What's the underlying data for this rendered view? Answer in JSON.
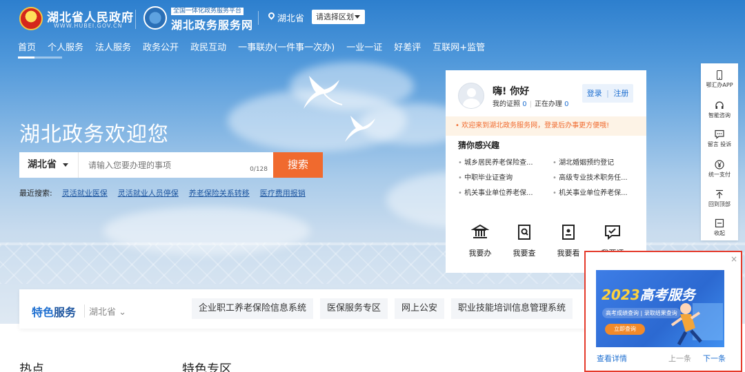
{
  "header": {
    "gov_name": "湖北省人民政府",
    "gov_url": "WWW.HUBEI.GOV.CN",
    "portal_tag": "全国一体化政务服务平台",
    "portal_name": "湖北政务服务网",
    "location": "湖北省",
    "region_select": "请选择区划"
  },
  "nav": {
    "items": [
      "首页",
      "个人服务",
      "法人服务",
      "政务公开",
      "政民互动",
      "一事联办(一件事一次办)",
      "一业一证",
      "好差评",
      "互联网+监管"
    ]
  },
  "hero": {
    "welcome": "湖北政务欢迎您",
    "search": {
      "region": "湖北省",
      "placeholder": "请输入您要办理的事项",
      "count": "0/128",
      "button": "搜索"
    },
    "recent": {
      "label": "最近搜索:",
      "items": [
        "灵活就业医保",
        "灵活就业人员停保",
        "养老保险关系转移",
        "医疗费用报销"
      ]
    }
  },
  "user_panel": {
    "greeting": "嗨! 你好",
    "license_label": "我的证照",
    "license_count": "0",
    "processing_label": "正在办理",
    "processing_count": "0",
    "login": "登录",
    "register": "注册",
    "notice": "欢迎来到湖北政务服务网，登录后办事更方便哦!",
    "interest_title": "猜你感兴趣",
    "interests": [
      "城乡居民养老保险查...",
      "湖北婚姻预约登记",
      "中职毕业证查询",
      "高级专业技术职务任...",
      "机关事业单位养老保...",
      "机关事业单位养老保..."
    ],
    "quick": [
      "我要办",
      "我要查",
      "我要看",
      "我要评"
    ]
  },
  "side_bar": {
    "items": [
      "鄂汇办APP",
      "智能咨询",
      "留言 投诉",
      "统一支付",
      "回到顶部",
      "收起"
    ]
  },
  "popup": {
    "close": "×",
    "banner_year": "2023",
    "banner_title": "高考服务",
    "banner_links": "高考成绩查询 | 录取结果查询",
    "banner_button": "立即查询",
    "detail": "查看详情",
    "prev": "上一条",
    "next": "下一条"
  },
  "features": {
    "title_a": "特色",
    "title_b": "服务",
    "region": "湖北省",
    "tabs": [
      "企业职工养老保险信息系统",
      "医保服务专区",
      "网上公安",
      "职业技能培训信息管理系统"
    ]
  },
  "bottom": {
    "hot": "热点",
    "special": "特色专区"
  },
  "colors": {
    "accent_orange": "#f06a2e",
    "link_blue": "#1e6fd0",
    "popup_border": "#e53a2a"
  }
}
